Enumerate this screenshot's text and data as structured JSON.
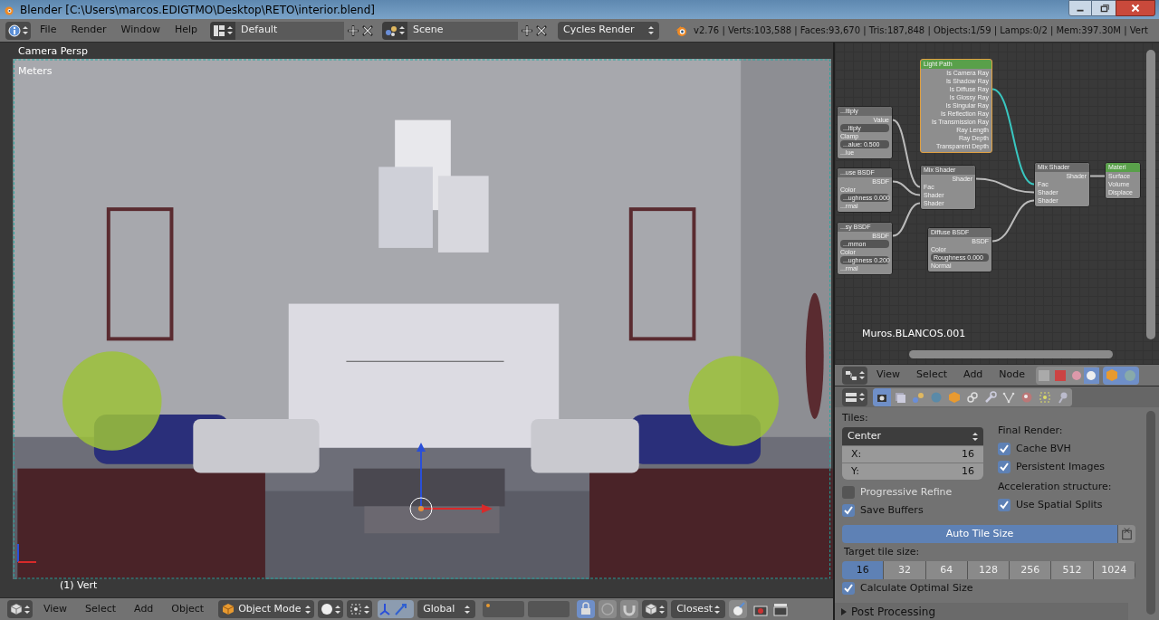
{
  "window": {
    "title": "Blender [C:\\Users\\marcos.EDIGTMO\\Desktop\\RETO\\interior.blend]"
  },
  "top_header": {
    "menus": [
      "File",
      "Render",
      "Window",
      "Help"
    ],
    "screen_layout": "Default",
    "scene": "Scene",
    "render_engine": "Cycles Render",
    "stats": "v2.76 | Verts:103,588 | Faces:93,670 | Tris:187,848 | Objects:1/59 | Lamps:0/2 | Mem:397.30M | Vert"
  },
  "viewport": {
    "view_name": "Camera Persp",
    "units": "Meters",
    "selection_info": "(1) Vert"
  },
  "node_editor": {
    "material_name": "Muros.BLANCOS.001",
    "nodes": [
      {
        "kind": "cut",
        "title": "...ltiply",
        "rows": [
          {
            "kind": "output",
            "label": "Value"
          },
          {
            "kind": "field",
            "label": "...ltiply"
          },
          {
            "kind": "input",
            "label": "Clamp"
          },
          {
            "kind": "field",
            "label": "...alue: 0.500"
          },
          {
            "kind": "input",
            "label": "...lue"
          }
        ]
      },
      {
        "kind": "cut",
        "title": "...use BSDF",
        "rows": [
          {
            "kind": "output",
            "label": "BSDF"
          },
          {
            "kind": "input",
            "label": "Color"
          },
          {
            "kind": "field",
            "label": "...ughness 0.000"
          },
          {
            "kind": "input",
            "label": "...rmal"
          }
        ]
      },
      {
        "kind": "cut",
        "title": "...sy BSDF",
        "rows": [
          {
            "kind": "output",
            "label": "BSDF"
          },
          {
            "kind": "field",
            "label": "...mmon"
          },
          {
            "kind": "input",
            "label": "Color"
          },
          {
            "kind": "field",
            "label": "...ughness 0.200"
          },
          {
            "kind": "input",
            "label": "...rmal"
          }
        ]
      },
      {
        "kind": "lightpath",
        "title": "Light Path",
        "rows": [
          {
            "kind": "output",
            "label": "Is Camera Ray"
          },
          {
            "kind": "output",
            "label": "Is Shadow Ray"
          },
          {
            "kind": "output",
            "label": "Is Diffuse Ray"
          },
          {
            "kind": "output",
            "label": "Is Glossy Ray"
          },
          {
            "kind": "output",
            "label": "Is Singular Ray"
          },
          {
            "kind": "output",
            "label": "Is Reflection Ray"
          },
          {
            "kind": "output",
            "label": "Is Transmission Ray"
          },
          {
            "kind": "output",
            "label": "Ray Length"
          },
          {
            "kind": "output",
            "label": "Ray Depth"
          },
          {
            "kind": "output",
            "label": "Transparent Depth"
          }
        ]
      },
      {
        "kind": "shader",
        "title": "Mix Shader",
        "rows": [
          {
            "kind": "output",
            "label": "Shader"
          },
          {
            "kind": "input",
            "label": "Fac"
          },
          {
            "kind": "input",
            "label": "Shader"
          },
          {
            "kind": "input",
            "label": "Shader"
          }
        ]
      },
      {
        "kind": "shader",
        "title": "Mix Shader",
        "rows": [
          {
            "kind": "output",
            "label": "Shader"
          },
          {
            "kind": "input",
            "label": "Fac"
          },
          {
            "kind": "input",
            "label": "Shader"
          },
          {
            "kind": "input",
            "label": "Shader"
          }
        ]
      },
      {
        "kind": "shader",
        "title": "Diffuse BSDF",
        "rows": [
          {
            "kind": "output",
            "label": "BSDF"
          },
          {
            "kind": "input",
            "label": "Color"
          },
          {
            "kind": "field",
            "label": "Roughness 0.000"
          },
          {
            "kind": "input",
            "label": "Normal"
          }
        ]
      },
      {
        "kind": "output",
        "title": "Materi",
        "rows": [
          {
            "kind": "input",
            "label": "Surface"
          },
          {
            "kind": "input",
            "label": "Volume"
          },
          {
            "kind": "input",
            "label": "Displace"
          }
        ]
      }
    ],
    "header_menus": [
      "View",
      "Select",
      "Add",
      "Node"
    ]
  },
  "properties": {
    "tabs": [
      {
        "kind": "render",
        "selected": true
      },
      {
        "kind": "layers",
        "selected": false
      },
      {
        "kind": "scene",
        "selected": false
      },
      {
        "kind": "world",
        "selected": false
      },
      {
        "kind": "object",
        "selected": false
      },
      {
        "kind": "constraints",
        "selected": false
      },
      {
        "kind": "modifiers",
        "selected": false
      },
      {
        "kind": "data",
        "selected": false
      },
      {
        "kind": "material",
        "selected": false
      },
      {
        "kind": "texture",
        "selected": false
      },
      {
        "kind": "physics",
        "selected": false
      }
    ],
    "tiles_label": "Tiles:",
    "tile_order": "Center",
    "tile_x": {
      "label": "X:",
      "value": "16"
    },
    "tile_y": {
      "label": "Y:",
      "value": "16"
    },
    "left_options": [
      {
        "label": "Progressive Refine",
        "checked": false
      },
      {
        "label": "Save Buffers",
        "checked": true
      }
    ],
    "final_render_label": "Final Render:",
    "final_render_options": [
      {
        "label": "Cache BVH",
        "checked": true
      },
      {
        "label": "Persistent Images",
        "checked": true
      }
    ],
    "acceleration_label": "Acceleration structure:",
    "acceleration_options": [
      {
        "label": "Use Spatial Splits",
        "checked": true
      }
    ],
    "auto_tile_size": {
      "label": "Auto Tile Size",
      "on": true
    },
    "target_label": "Target tile size:",
    "tile_sizes": [
      {
        "label": "16",
        "selected": true
      },
      {
        "label": "32",
        "selected": false
      },
      {
        "label": "64",
        "selected": false
      },
      {
        "label": "128",
        "selected": false
      },
      {
        "label": "256",
        "selected": false
      },
      {
        "label": "512",
        "selected": false
      },
      {
        "label": "1024",
        "selected": false
      }
    ],
    "calculate_optimal": {
      "label": "Calculate Optimal Size",
      "checked": true
    },
    "post_processing": {
      "label": "Post Processing",
      "expanded": false
    }
  },
  "bottom_header": {
    "menus": [
      "View",
      "Select",
      "Add",
      "Object"
    ],
    "mode": "Object Mode",
    "orientation": "Global",
    "snap_target": "Closest"
  }
}
